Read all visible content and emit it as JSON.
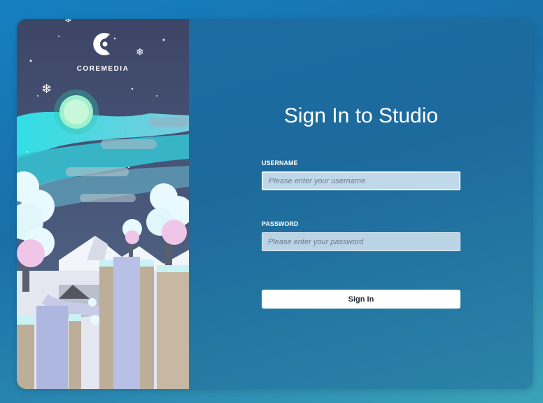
{
  "brand": {
    "name": "COREMEDIA",
    "logo_icon": "coremedia-logo-icon"
  },
  "login": {
    "title": "Sign In to Studio",
    "username_label": "USERNAME",
    "username_placeholder": "Please enter your username",
    "password_label": "PASSWORD",
    "password_placeholder": "Please enter your password",
    "submit_label": "Sign In"
  },
  "colors": {
    "background": "#1a6fa8",
    "panel": "#1d6a9d",
    "button": "#ffffff",
    "art_sky": "#404a6b",
    "aurora": "#37d6e0"
  }
}
